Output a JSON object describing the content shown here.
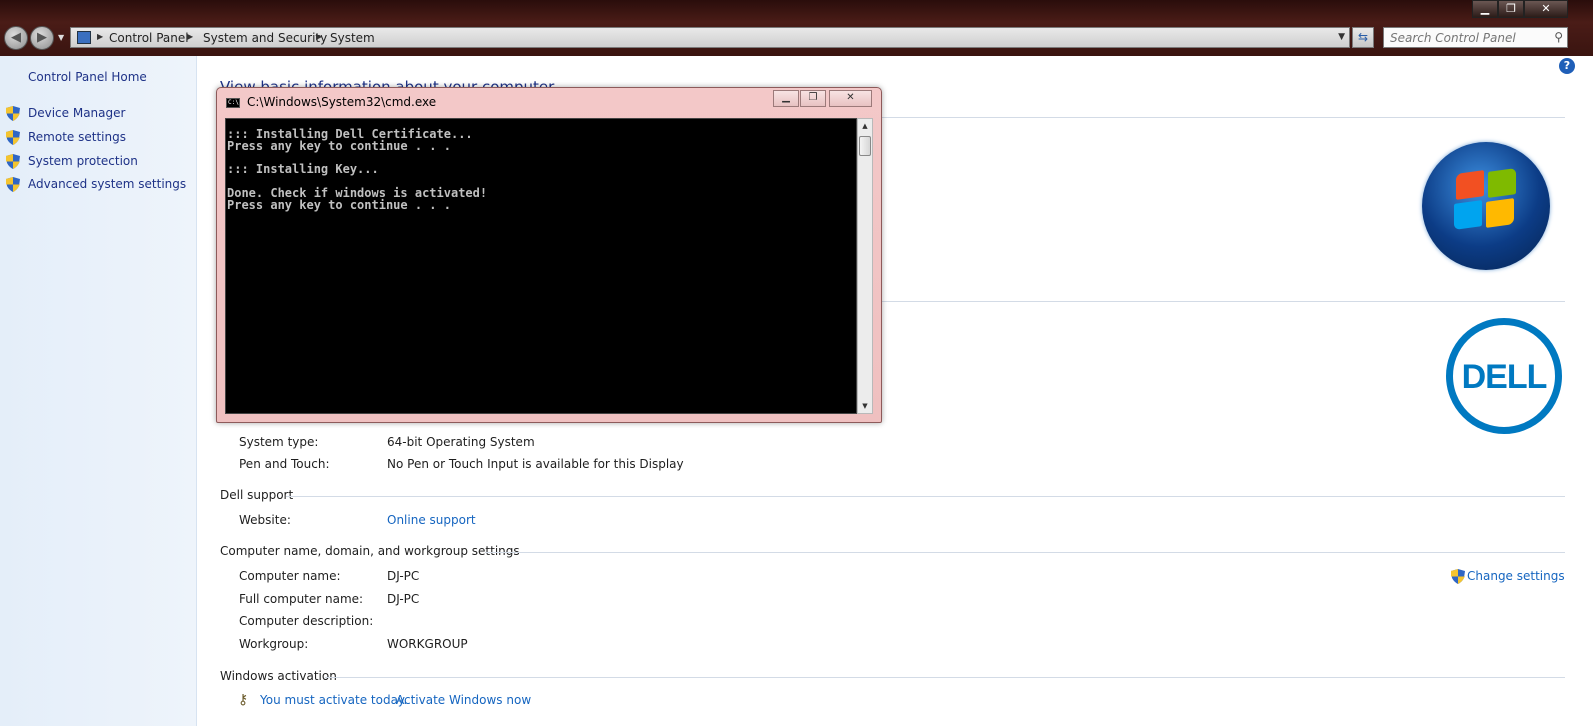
{
  "window": {
    "controls": {
      "minimize": "▁",
      "maximize": "❐",
      "close": "✕"
    }
  },
  "address_bar": {
    "crumbs": [
      "Control Panel",
      "System and Security",
      "System"
    ],
    "search_placeholder": "Search Control Panel"
  },
  "left_pane": {
    "home_label": "Control Panel Home",
    "links": [
      "Device Manager",
      "Remote settings",
      "System protection",
      "Advanced system settings"
    ]
  },
  "main": {
    "page_title": "View basic information about your computer",
    "system_rows": [
      {
        "label": "System type:",
        "value": "64-bit Operating System"
      },
      {
        "label": "Pen and Touch:",
        "value": "No Pen or Touch Input is available for this Display"
      }
    ],
    "dell_support": {
      "heading": "Dell support",
      "website_label": "Website:",
      "website_value": "Online support"
    },
    "computer_name": {
      "heading": "Computer name, domain, and workgroup settings",
      "rows": [
        {
          "label": "Computer name:",
          "value": "DJ-PC"
        },
        {
          "label": "Full computer name:",
          "value": "DJ-PC"
        },
        {
          "label": "Computer description:",
          "value": ""
        },
        {
          "label": "Workgroup:",
          "value": "WORKGROUP"
        }
      ],
      "change_settings": "Change settings"
    },
    "activation": {
      "heading": "Windows activation",
      "message": "You must activate today.",
      "link": "Activate Windows now"
    },
    "dell_logo_text": "DELL"
  },
  "cmd": {
    "title": "C:\\Windows\\System32\\cmd.exe",
    "lines": [
      "::: Installing Dell Certificate...",
      "Press any key to continue . . .",
      "",
      "::: Installing Key...",
      "",
      "Done. Check if windows is activated!",
      "Press any key to continue . . ."
    ]
  },
  "colors": {
    "link": "#1565c0",
    "nav_link": "#1e3287",
    "dell_blue": "#0079c1",
    "cmd_frame": "#f3c8c8"
  }
}
